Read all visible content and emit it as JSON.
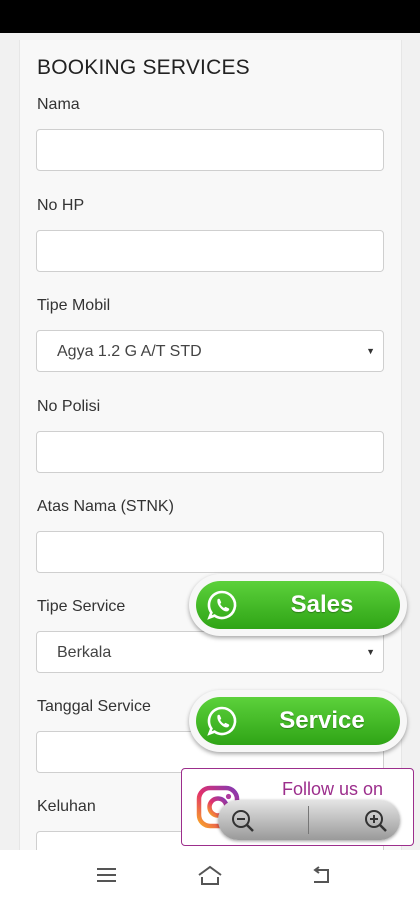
{
  "form": {
    "title": "BOOKING SERVICES",
    "fields": [
      {
        "label": "Nama",
        "value": ""
      },
      {
        "label": "No HP",
        "value": ""
      },
      {
        "label": "Tipe Mobil",
        "value": "Agya 1.2 G A/T STD"
      },
      {
        "label": "No Polisi",
        "value": ""
      },
      {
        "label": "Atas Nama (STNK)",
        "value": ""
      },
      {
        "label": "Tipe Service",
        "value": "Berkala"
      },
      {
        "label": "Tanggal Service",
        "value": ""
      },
      {
        "label": "Keluhan",
        "value": ""
      }
    ]
  },
  "whatsapp": {
    "sales_label": "Sales",
    "service_label": "Service",
    "color": "#3cb521"
  },
  "instagram": {
    "follow_text": "Follow us on",
    "color": "#9c2e8c"
  },
  "icons": {
    "whatsapp": "whatsapp-icon",
    "instagram": "instagram-icon",
    "zoom_out": "zoom-out-icon",
    "zoom_in": "zoom-in-icon",
    "nav_menu": "menu-icon",
    "nav_home": "home-icon",
    "nav_back": "back-icon"
  }
}
